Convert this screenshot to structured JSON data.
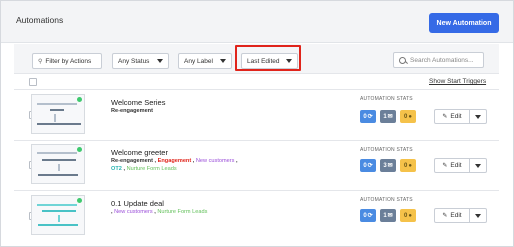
{
  "page_title": "Automations",
  "new_button": "New Automation",
  "filters": {
    "actions": "Filter by Actions",
    "status": "Any Status",
    "label": "Any Label",
    "sort": "Last Edited",
    "search_placeholder": "Search Automations..."
  },
  "show_start_triggers": "Show Start Triggers",
  "stats_header": "AUTOMATION STATS",
  "edit_label": "Edit",
  "colors": {
    "accent": "#356ae6",
    "highlight": "#e0241b",
    "active_dot": "#3ec96e"
  },
  "rows": [
    {
      "name": "Welcome Series",
      "labels": [
        {
          "text": "Re-engagement",
          "style": "plain"
        }
      ],
      "stats": [
        "0",
        "1",
        "0"
      ]
    },
    {
      "name": "Welcome greeter",
      "labels": [
        {
          "text": "Re-engagement",
          "style": "plain"
        },
        {
          "text": "Engagement",
          "style": "red"
        },
        {
          "text": "New customers",
          "style": "purple"
        },
        {
          "text": "OT2",
          "style": "teal"
        },
        {
          "text": "Nurture Form Leads",
          "style": "green"
        }
      ],
      "stats": [
        "0",
        "3",
        "0"
      ]
    },
    {
      "name": "0.1 Update deal",
      "labels": [
        {
          "text": "New customers",
          "style": "purple"
        },
        {
          "text": "Nurture Form Leads",
          "style": "green"
        }
      ],
      "stats": [
        "0",
        "1",
        "0"
      ]
    }
  ]
}
